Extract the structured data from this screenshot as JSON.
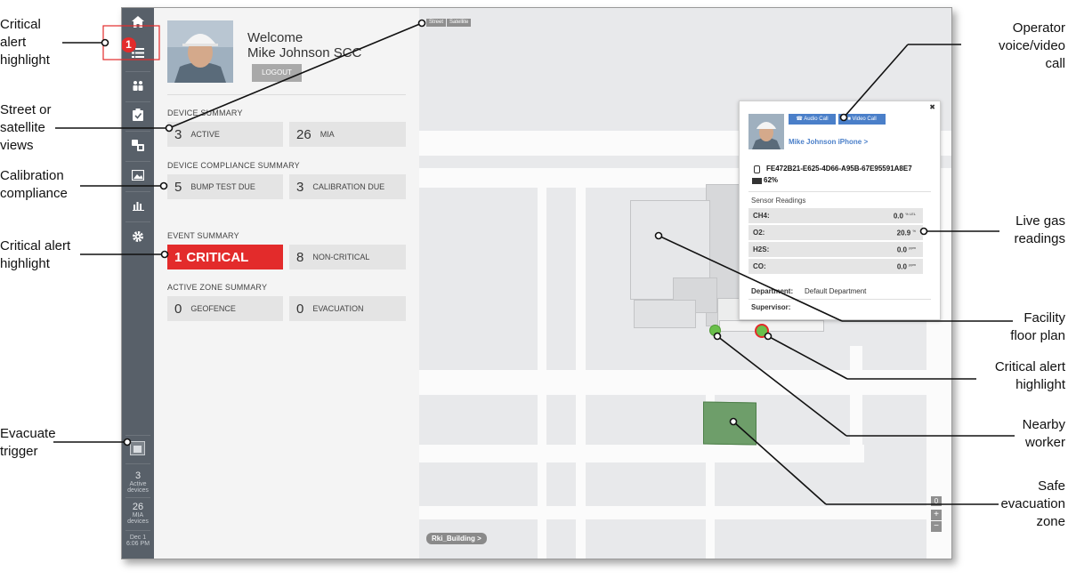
{
  "sidebar": {
    "alert_count": "1",
    "stats": [
      {
        "num": "3",
        "label1": "Active",
        "label2": "devices"
      },
      {
        "num": "26",
        "label1": "MIA",
        "label2": "devices"
      }
    ],
    "date": "Dec 1",
    "time": "6:06 PM"
  },
  "user": {
    "welcome": "Welcome",
    "name": "Mike Johnson SCC",
    "logout_label": "LOGOUT"
  },
  "device_summary": {
    "title": "DEVICE SUMMARY",
    "active_num": "3",
    "active_label": "ACTIVE",
    "mia_num": "26",
    "mia_label": "MIA"
  },
  "compliance_summary": {
    "title": "DEVICE COMPLIANCE SUMMARY",
    "bump_num": "5",
    "bump_label": "BUMP TEST DUE",
    "calib_num": "3",
    "calib_label": "CALIBRATION DUE"
  },
  "event_summary": {
    "title": "EVENT SUMMARY",
    "critical_num": "1",
    "critical_label": "CRITICAL",
    "noncritical_num": "8",
    "noncritical_label": "NON-CRITICAL"
  },
  "zone_summary": {
    "title": "ACTIVE ZONE SUMMARY",
    "geofence_num": "0",
    "geofence_label": "GEOFENCE",
    "evac_num": "0",
    "evac_label": "EVACUATION"
  },
  "map": {
    "street_label": "Street",
    "satellite_label": "Satellite",
    "building_label": "Rki_Building >",
    "zoom_in": "+",
    "zoom_out": "−",
    "reset": "0",
    "colors": {
      "critical": "#e32b2b",
      "worker": "#6abf4b",
      "safe_zone": "#6e9e6a"
    }
  },
  "card": {
    "close": "✖",
    "audio_label": "Audio Call",
    "video_label": "Video Call",
    "device_name": "Mike Johnson iPhone >",
    "device_id": "FE472B21-E625-4D66-A95B-67E95591A8E7",
    "battery": "62%",
    "sensor_title": "Sensor Readings",
    "readings": [
      {
        "key": "CH4:",
        "value": "0.0",
        "unit": "% LEL"
      },
      {
        "key": "O2:",
        "value": "20.9",
        "unit": "%"
      },
      {
        "key": "H2S:",
        "value": "0.0",
        "unit": "ppm"
      },
      {
        "key": "CO:",
        "value": "0.0",
        "unit": "ppm"
      }
    ],
    "department_label": "Department:",
    "department_value": "Default Department",
    "supervisor_label": "Supervisor:"
  },
  "callouts": {
    "critical_alert_top": [
      "Critical",
      "alert",
      "highlight"
    ],
    "street_satellite": [
      "Street or",
      "satellite",
      "views"
    ],
    "calibration": [
      "Calibration",
      "compliance"
    ],
    "critical_alert_mid": [
      "Critical alert",
      "highlight"
    ],
    "evacuate": [
      "Evacuate",
      "trigger"
    ],
    "operator_call": [
      "Operator",
      "voice/video",
      "call"
    ],
    "live_gas": [
      "Live gas",
      "readings"
    ],
    "facility": [
      "Facility",
      "floor plan"
    ],
    "critical_alert_right": [
      "Critical alert",
      "highlight"
    ],
    "nearby_worker": [
      "Nearby",
      "worker"
    ],
    "safe_zone": [
      "Safe",
      "evacuation",
      "zone"
    ]
  }
}
